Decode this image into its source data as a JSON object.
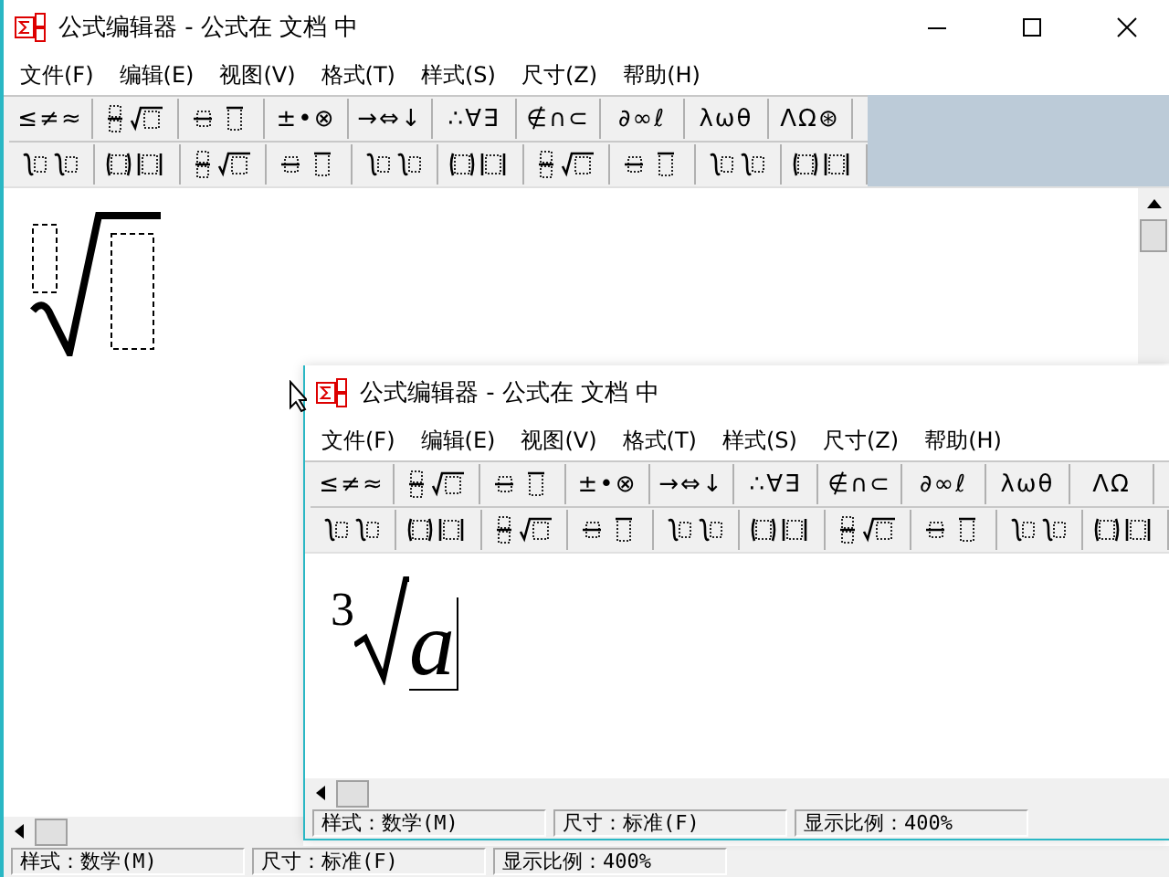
{
  "windows": [
    {
      "title": "公式编辑器 - 公式在 文档 中",
      "caption_buttons": true,
      "vertical_scrollbar": true,
      "menu": [
        "文件(F)",
        "编辑(E)",
        "视图(V)",
        "格式(T)",
        "样式(S)",
        "尺寸(Z)",
        "帮助(H)"
      ],
      "toolbar": {
        "rows": [
          [
            {
              "kind": "symbols",
              "text": "≤≠≈"
            },
            {
              "kind": "template"
            },
            {
              "kind": "template"
            },
            {
              "kind": "symbols",
              "text": "±•⊗"
            },
            {
              "kind": "symbols",
              "text": "→⇔↓"
            },
            {
              "kind": "symbols",
              "text": "∴∀∃"
            },
            {
              "kind": "symbols",
              "text": "∉∩⊂"
            },
            {
              "kind": "symbols",
              "text": "∂∞ℓ"
            },
            {
              "kind": "symbols",
              "text": "λωθ"
            },
            {
              "kind": "symbols",
              "text": "ΛΩ⊛"
            }
          ],
          [
            {
              "kind": "template"
            },
            {
              "kind": "template"
            },
            {
              "kind": "template"
            },
            {
              "kind": "template"
            },
            {
              "kind": "template"
            },
            {
              "kind": "template"
            },
            {
              "kind": "template"
            },
            {
              "kind": "template"
            },
            {
              "kind": "template"
            },
            {
              "kind": "template"
            }
          ]
        ]
      },
      "equation": {
        "kind": "template"
      },
      "status_bar": [
        "样式：数学(M)",
        "尺寸：标准(F)",
        "显示比例：400%"
      ]
    },
    {
      "title": "公式编辑器 - 公式在 文档 中",
      "caption_buttons": false,
      "vertical_scrollbar": false,
      "menu": [
        "文件(F)",
        "编辑(E)",
        "视图(V)",
        "格式(T)",
        "样式(S)",
        "尺寸(Z)",
        "帮助(H)"
      ],
      "toolbar": {
        "rows": [
          [
            {
              "kind": "symbols",
              "text": "≤≠≈"
            },
            {
              "kind": "template"
            },
            {
              "kind": "template"
            },
            {
              "kind": "symbols",
              "text": "±•⊗"
            },
            {
              "kind": "symbols",
              "text": "→⇔↓"
            },
            {
              "kind": "symbols",
              "text": "∴∀∃"
            },
            {
              "kind": "symbols",
              "text": "∉∩⊂"
            },
            {
              "kind": "symbols",
              "text": "∂∞ℓ"
            },
            {
              "kind": "symbols",
              "text": "λωθ"
            },
            {
              "kind": "symbols",
              "text": "ΛΩ"
            }
          ],
          [
            {
              "kind": "template"
            },
            {
              "kind": "template"
            },
            {
              "kind": "template"
            },
            {
              "kind": "template"
            },
            {
              "kind": "template"
            },
            {
              "kind": "template"
            },
            {
              "kind": "template"
            },
            {
              "kind": "template"
            },
            {
              "kind": "template"
            },
            {
              "kind": "template"
            }
          ]
        ]
      },
      "equation": {
        "kind": "filled",
        "index": "3",
        "radicand": "a"
      },
      "status_bar": [
        "样式：数学(M)",
        "尺寸：标准(F)",
        "显示比例：400%"
      ]
    }
  ]
}
